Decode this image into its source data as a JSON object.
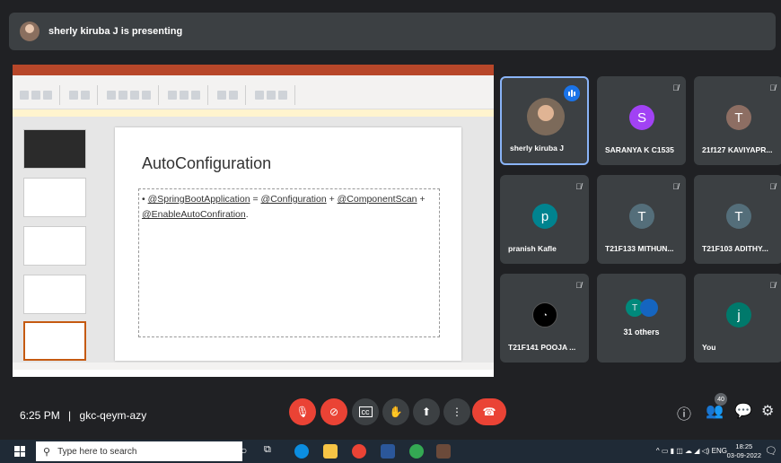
{
  "banner": {
    "presenting": "sherly kiruba J is presenting"
  },
  "slide": {
    "title": "AutoConfiguration",
    "bullet_parts": [
      "@SpringBootApplication",
      " = ",
      "@Configuration",
      " + ",
      "@ComponentScan",
      " + ",
      "@EnableAutoConfiration",
      "."
    ]
  },
  "participants": [
    {
      "name": "sherly kiruba J",
      "initial": "",
      "color": "",
      "speaking": true
    },
    {
      "name": "SARANYA K C1535",
      "initial": "S",
      "color": "#a142f4",
      "speaking": false
    },
    {
      "name": "21f127 KAVIYAPR...",
      "initial": "T",
      "color": "#8d6e63",
      "speaking": false
    },
    {
      "name": "pranish Kafle",
      "initial": "p",
      "color": "#00838f",
      "speaking": false
    },
    {
      "name": "T21F133 MITHUN...",
      "initial": "T",
      "color": "#546e7a",
      "speaking": false
    },
    {
      "name": "T21F103 ADITHY...",
      "initial": "T",
      "color": "#546e7a",
      "speaking": false
    },
    {
      "name": "T21F141 POOJA ...",
      "initial": "",
      "color": "#000000",
      "speaking": false
    },
    {
      "name": "31 others",
      "initial": "",
      "color": "",
      "speaking": false
    },
    {
      "name": "You",
      "initial": "j",
      "color": "#00796b",
      "speaking": false
    }
  ],
  "meeting": {
    "time": "6:25 PM",
    "separator": "|",
    "code": "gkc-qeym-azy"
  },
  "people_count": "40",
  "taskbar": {
    "search_placeholder": "Type here to search",
    "lang": "ENG",
    "time": "18:25",
    "date": "03-09-2022"
  },
  "colors": {
    "end_call": "#ea4335",
    "mute_red": "#ea4335",
    "speaking": "#1a73e8",
    "ppt_brand": "#b7472a"
  }
}
